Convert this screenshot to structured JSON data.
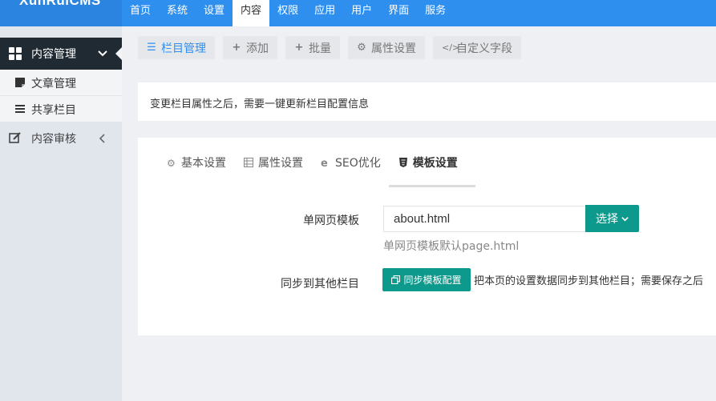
{
  "app": {
    "logo_text": "XunRuiCMS"
  },
  "nav": [
    "首页",
    "系统",
    "设置",
    "内容",
    "权限",
    "应用",
    "用户",
    "界面",
    "服务"
  ],
  "nav_active": 3,
  "sidebar": {
    "group": "内容管理",
    "subitems": [
      "文章管理",
      "共享栏目"
    ],
    "item": "内容审核"
  },
  "toolbar": [
    "栏目管理",
    "添加",
    "批量",
    "属性设置",
    "自定义字段"
  ],
  "notice": "变更栏目属性之后，需要一键更新栏目配置信息",
  "tabs": [
    "基本设置",
    "属性设置",
    "SEO优化",
    "模板设置"
  ],
  "form": {
    "template_label": "单网页模板",
    "template_value": "about.html",
    "select_label": "选择",
    "template_hint": "单网页模板默认page.html",
    "sync_label": "同步到其他栏目",
    "sync_button": "同步模板配置",
    "sync_desc": "把本页的设置数据同步到其他栏目；需要保存之后"
  },
  "colors": {
    "topbar": "#2f8fef",
    "accent": "#0d9a8c",
    "sidebar_dark": "#1f2a33"
  }
}
